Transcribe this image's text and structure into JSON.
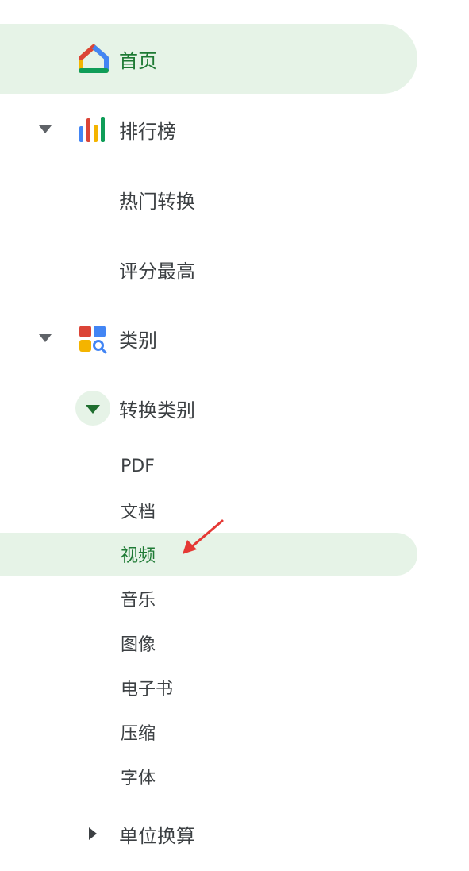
{
  "nav": {
    "home": {
      "label": "首页",
      "icon": "home-icon"
    },
    "rankings": {
      "label": "排行榜",
      "icon": "bar-chart-icon",
      "items": [
        "热门转换",
        "评分最高"
      ]
    },
    "categories": {
      "label": "类别",
      "icon": "categories-icon",
      "conversion": {
        "label": "转换类别",
        "items": [
          "PDF",
          "文档",
          "视频",
          "音乐",
          "图像",
          "电子书",
          "压缩",
          "字体"
        ],
        "selected": "视频"
      },
      "unit_conversion": {
        "label": "单位换算"
      }
    }
  },
  "colors": {
    "active_bg": "#e6f3e7",
    "active_text": "#1e7a34",
    "annotation_arrow": "#e53935"
  }
}
